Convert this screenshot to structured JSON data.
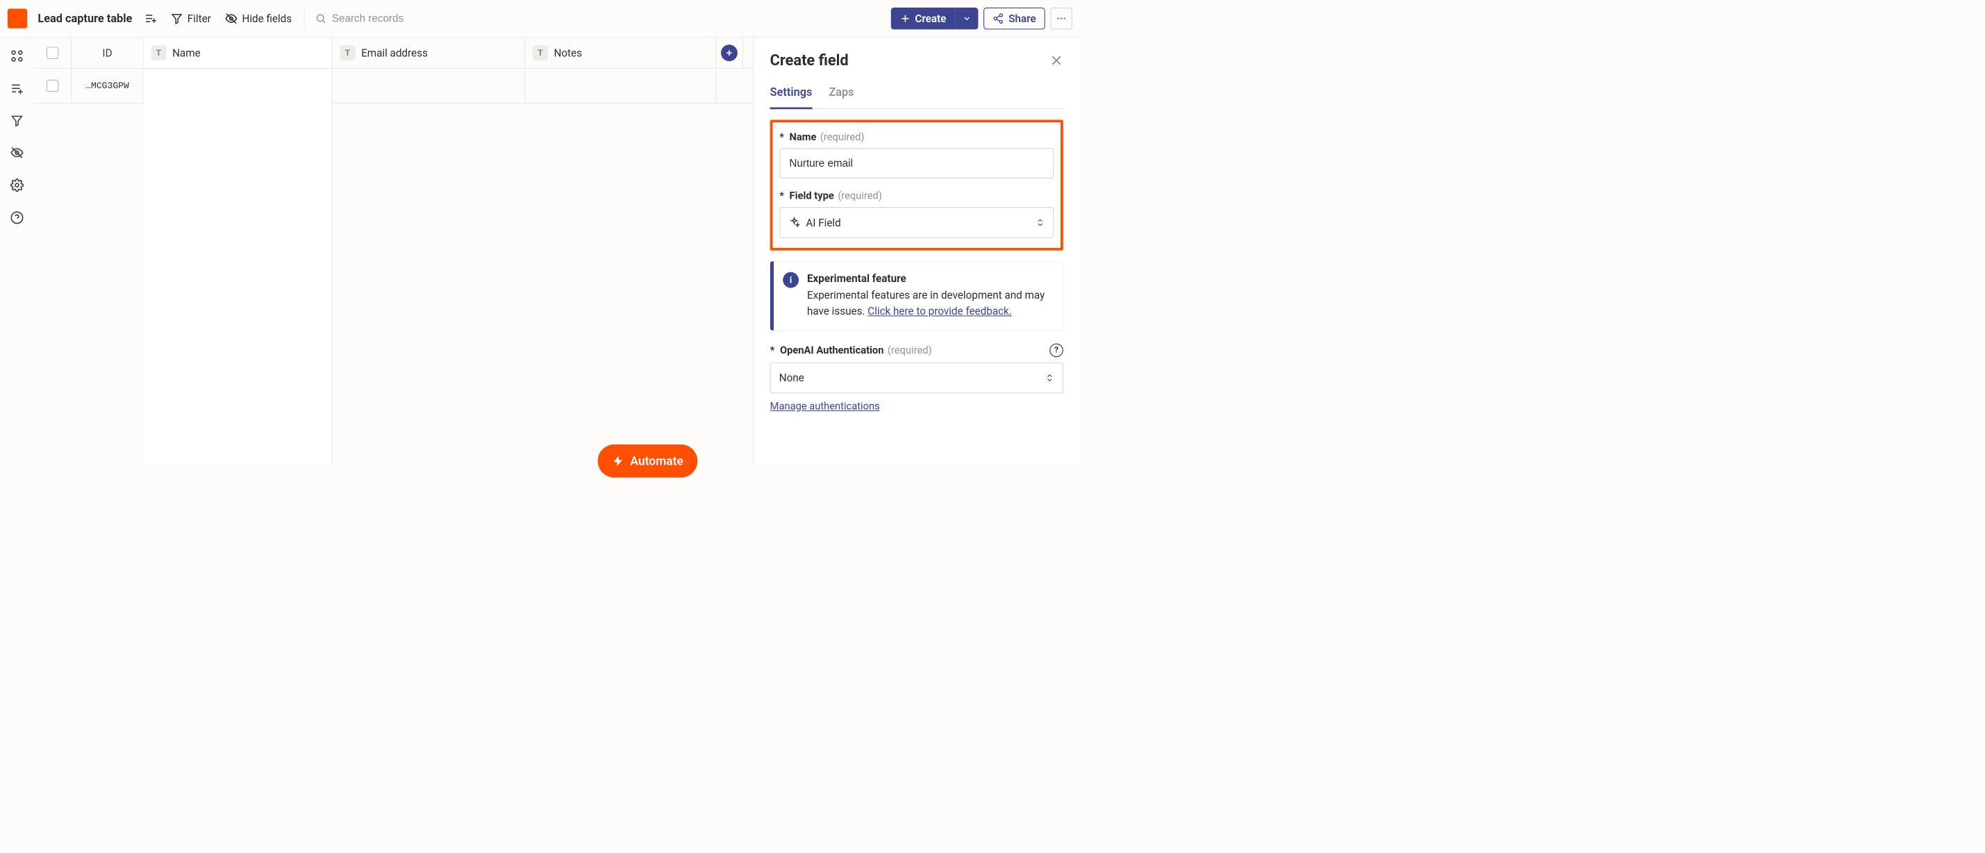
{
  "header": {
    "table_title": "Lead capture table",
    "filter_label": "Filter",
    "hide_fields_label": "Hide fields",
    "search_placeholder": "Search records",
    "create_label": "Create",
    "share_label": "Share"
  },
  "columns": {
    "id": "ID",
    "name": "Name",
    "email": "Email address",
    "notes": "Notes",
    "type_badge": "T"
  },
  "rows": [
    {
      "id": "…MCG3GPW",
      "name": "",
      "email": "",
      "notes": ""
    }
  ],
  "automate_label": "Automate",
  "panel": {
    "title": "Create field",
    "tabs": {
      "settings": "Settings",
      "zaps": "Zaps"
    },
    "name_label": "Name",
    "required_label": "(required)",
    "name_value": "Nurture email",
    "field_type_label": "Field type",
    "field_type_value": "AI Field",
    "info_title": "Experimental feature",
    "info_text_prefix": "Experimental features are in development and may have issues. ",
    "info_link": "Click here to provide feedback.",
    "auth_label": "OpenAI Authentication",
    "auth_value": "None",
    "manage_auth_link": "Manage authentications"
  }
}
